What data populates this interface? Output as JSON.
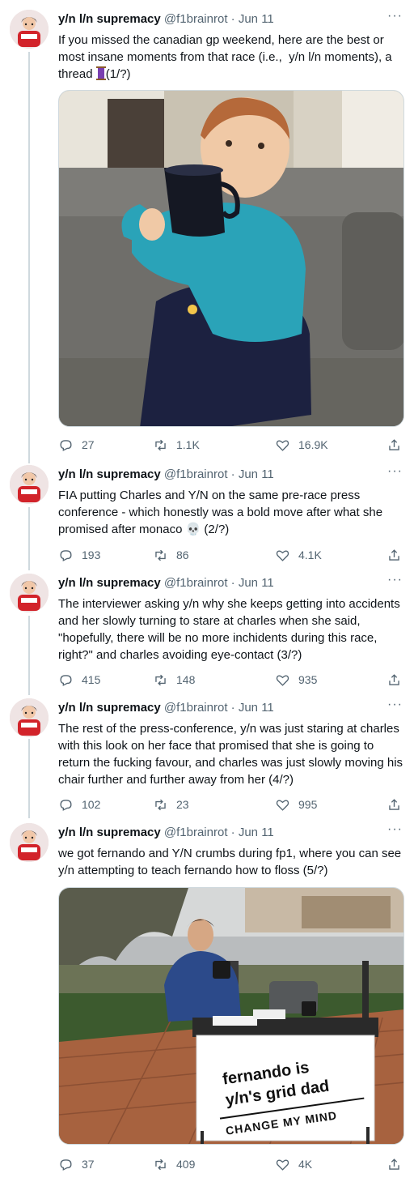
{
  "author": {
    "name": "y/n l/n supremacy",
    "handle": "@f1brainrot",
    "separator": "·"
  },
  "more_label": "···",
  "tweets": [
    {
      "date": "Jun 11",
      "text_before_emoji": "If you missed the canadian gp weekend, here are the best or most insane moments from that race (i.e.,  y/n l/n moments), a thread ",
      "emoji": "thread-spool-icon",
      "text_after_emoji": "(1/?)",
      "media": "meme-kid-drinking-from-mug",
      "replies": "27",
      "retweets": "1.1K",
      "likes": "16.9K"
    },
    {
      "date": "Jun 11",
      "text_before_emoji": "FIA putting Charles and Y/N on the same pre-race press conference - which honestly was a bold move after what she promised after monaco ",
      "emoji": "💀",
      "text_after_emoji": " (2/?)",
      "replies": "193",
      "retweets": "86",
      "likes": "4.1K"
    },
    {
      "date": "Jun 11",
      "text": "The interviewer asking y/n why she keeps getting into accidents and her slowly turning to stare at charles when she said, \"hopefully, there will be no more inchidents during this race, right?\" and charles avoiding eye-contact (3/?)",
      "replies": "415",
      "retweets": "148",
      "likes": "935"
    },
    {
      "date": "Jun 11",
      "text": "The rest of the press-conference, y/n was just staring at charles with this look on her face that promised that she is going to return the fucking favour, and charles was just slowly moving his chair further and further away from her (4/?)",
      "replies": "102",
      "retweets": "23",
      "likes": "995"
    },
    {
      "date": "Jun 11",
      "text": "we got fernando and Y/N crumbs during fp1, where you can see y/n attempting to teach fernando how to floss (5/?)",
      "media": "meme-change-my-mind",
      "sign_line1": "fernando is",
      "sign_line2": "y/n's grid dad",
      "sign_line3": "CHANGE MY MIND",
      "replies": "37",
      "retweets": "409",
      "likes": "4K"
    }
  ],
  "colors": {
    "text": "#0f1419",
    "secondary": "#536471",
    "thread_line": "#cfd9de"
  }
}
